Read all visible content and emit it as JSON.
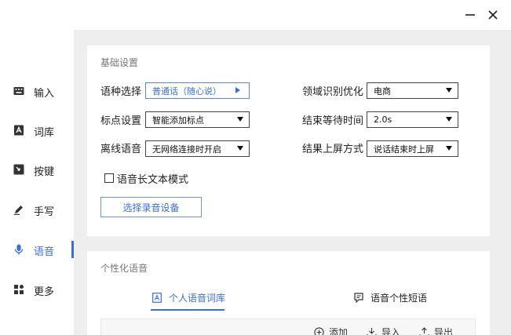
{
  "sidebar": {
    "items": [
      {
        "label": "输入",
        "icon": "keyboard-icon",
        "active": false
      },
      {
        "label": "词库",
        "icon": "dictionary-icon",
        "active": false
      },
      {
        "label": "按键",
        "icon": "key-icon",
        "active": false
      },
      {
        "label": "手写",
        "icon": "pen-icon",
        "active": false
      },
      {
        "label": "语音",
        "icon": "microphone-icon",
        "active": true
      },
      {
        "label": "更多",
        "icon": "grid-icon",
        "active": false
      }
    ]
  },
  "window": {
    "minimize_icon": "minimize-icon",
    "close_icon": "close-icon"
  },
  "basic": {
    "title": "基础设置",
    "language": {
      "label": "语种选择",
      "value": "普通话（随心说）"
    },
    "punctuation": {
      "label": "标点设置",
      "value": "智能添加标点"
    },
    "offline": {
      "label": "离线语音",
      "value": "无网络连接时开启"
    },
    "domain": {
      "label": "领域识别优化",
      "value": "电商"
    },
    "end_wait": {
      "label": "结束等待时间",
      "value": "2.0s"
    },
    "result_mode": {
      "label": "结果上屏方式",
      "value": "说话结束时上屏"
    },
    "long_text": {
      "label": "语音长文本模式",
      "checked": false
    },
    "device_button": "选择录音设备"
  },
  "personal": {
    "title": "个性化语音",
    "tabs": [
      {
        "label": "个人语音词库",
        "icon": "word-library-icon",
        "active": true
      },
      {
        "label": "语音个性短语",
        "icon": "phrase-icon",
        "active": false
      }
    ],
    "toolbar": {
      "add": "添加",
      "import": "导入",
      "export": "导出"
    }
  },
  "colors": {
    "accent": "#3a6fd8",
    "background": "#eeeeee",
    "card": "#ffffff"
  }
}
